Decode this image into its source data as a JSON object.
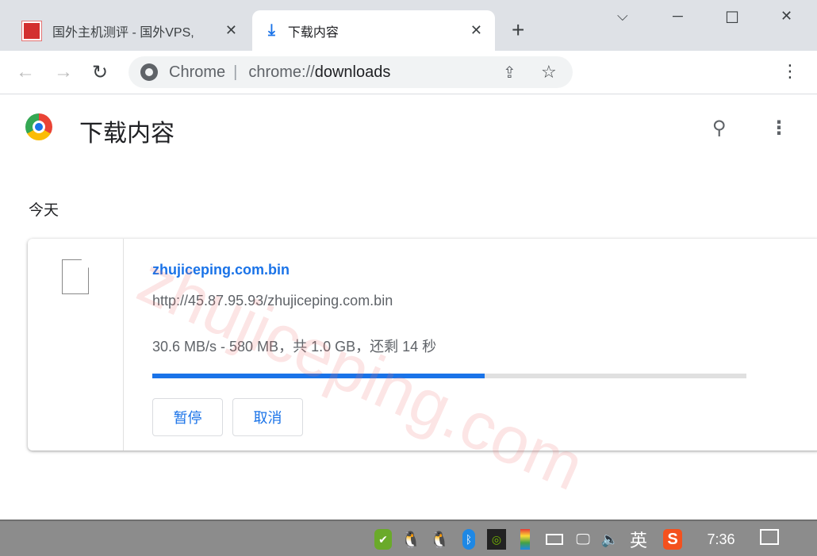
{
  "tabs": [
    {
      "title": "国外主机测评 - 国外VPS,",
      "close": "✕"
    },
    {
      "title": "下载内容",
      "icon": "download-icon",
      "close": "✕"
    }
  ],
  "new_tab": "+",
  "window": {
    "minimize": "─",
    "maximize": "☐",
    "close": "✕",
    "dropdown": "⌵"
  },
  "toolbar": {
    "back": "←",
    "forward": "→",
    "reload": "↻",
    "site_label": "Chrome",
    "separator": "|",
    "url_prefix": "chrome://",
    "url_path": "downloads",
    "share": "⇪",
    "star": "☆",
    "menu": "⋮"
  },
  "page": {
    "title": "下载内容",
    "search": "⚲",
    "menu": "⋮",
    "section": "今天"
  },
  "download": {
    "filename": "zhujiceping.com.bin",
    "url": "http://45.87.95.93/zhujiceping.com.bin",
    "status": "30.6 MB/s - 580 MB，共 1.0 GB，还剩 14 秒",
    "progress_percent": 56,
    "pause": "暂停",
    "cancel": "取消"
  },
  "watermark": "zhujiceping.com",
  "colors": {
    "accent": "#1a73e8",
    "taskbar": "#8c8c8c"
  },
  "taskbar": {
    "ime": "英",
    "clock": "7:36",
    "icons": [
      "security-icon",
      "qq-icon",
      "qq-icon",
      "bluetooth-icon",
      "nvidia-icon",
      "color-app-icon",
      "battery-icon",
      "network-icon",
      "volume-icon",
      "sogou-icon",
      "notification-icon"
    ]
  }
}
